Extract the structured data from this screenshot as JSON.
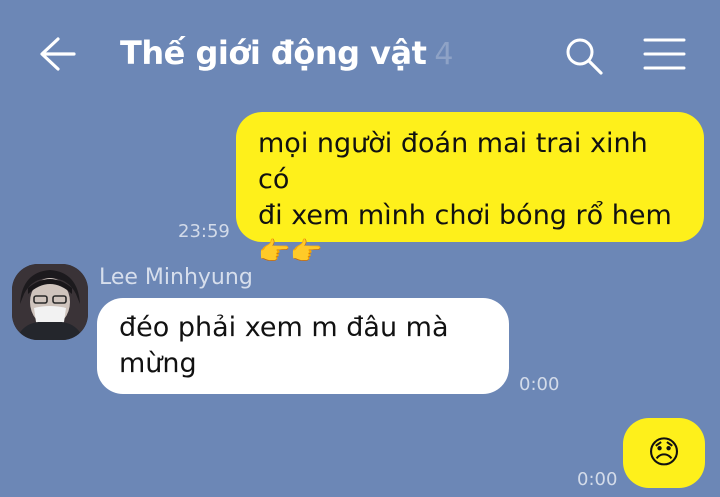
{
  "header": {
    "title": "Thế giới động vật",
    "member_count": "4"
  },
  "messages": [
    {
      "sender": "me",
      "line1": "mọi người đoán mai trai xinh có",
      "line2": "đi xem mình chơi bóng rổ hem",
      "line3": "👉👉",
      "time": "23:59"
    },
    {
      "sender": "Lee Minhyung",
      "line1": "đéo phải xem m đâu mà",
      "line2": "mừng",
      "time": "0:00"
    },
    {
      "sender": "me",
      "line1": "😞",
      "time": "0:00"
    }
  ],
  "colors": {
    "background": "#6c87b6",
    "my_bubble": "#fef01b",
    "other_bubble": "#ffffff"
  },
  "icons": [
    "back-arrow-icon",
    "search-icon",
    "hamburger-menu-icon"
  ]
}
